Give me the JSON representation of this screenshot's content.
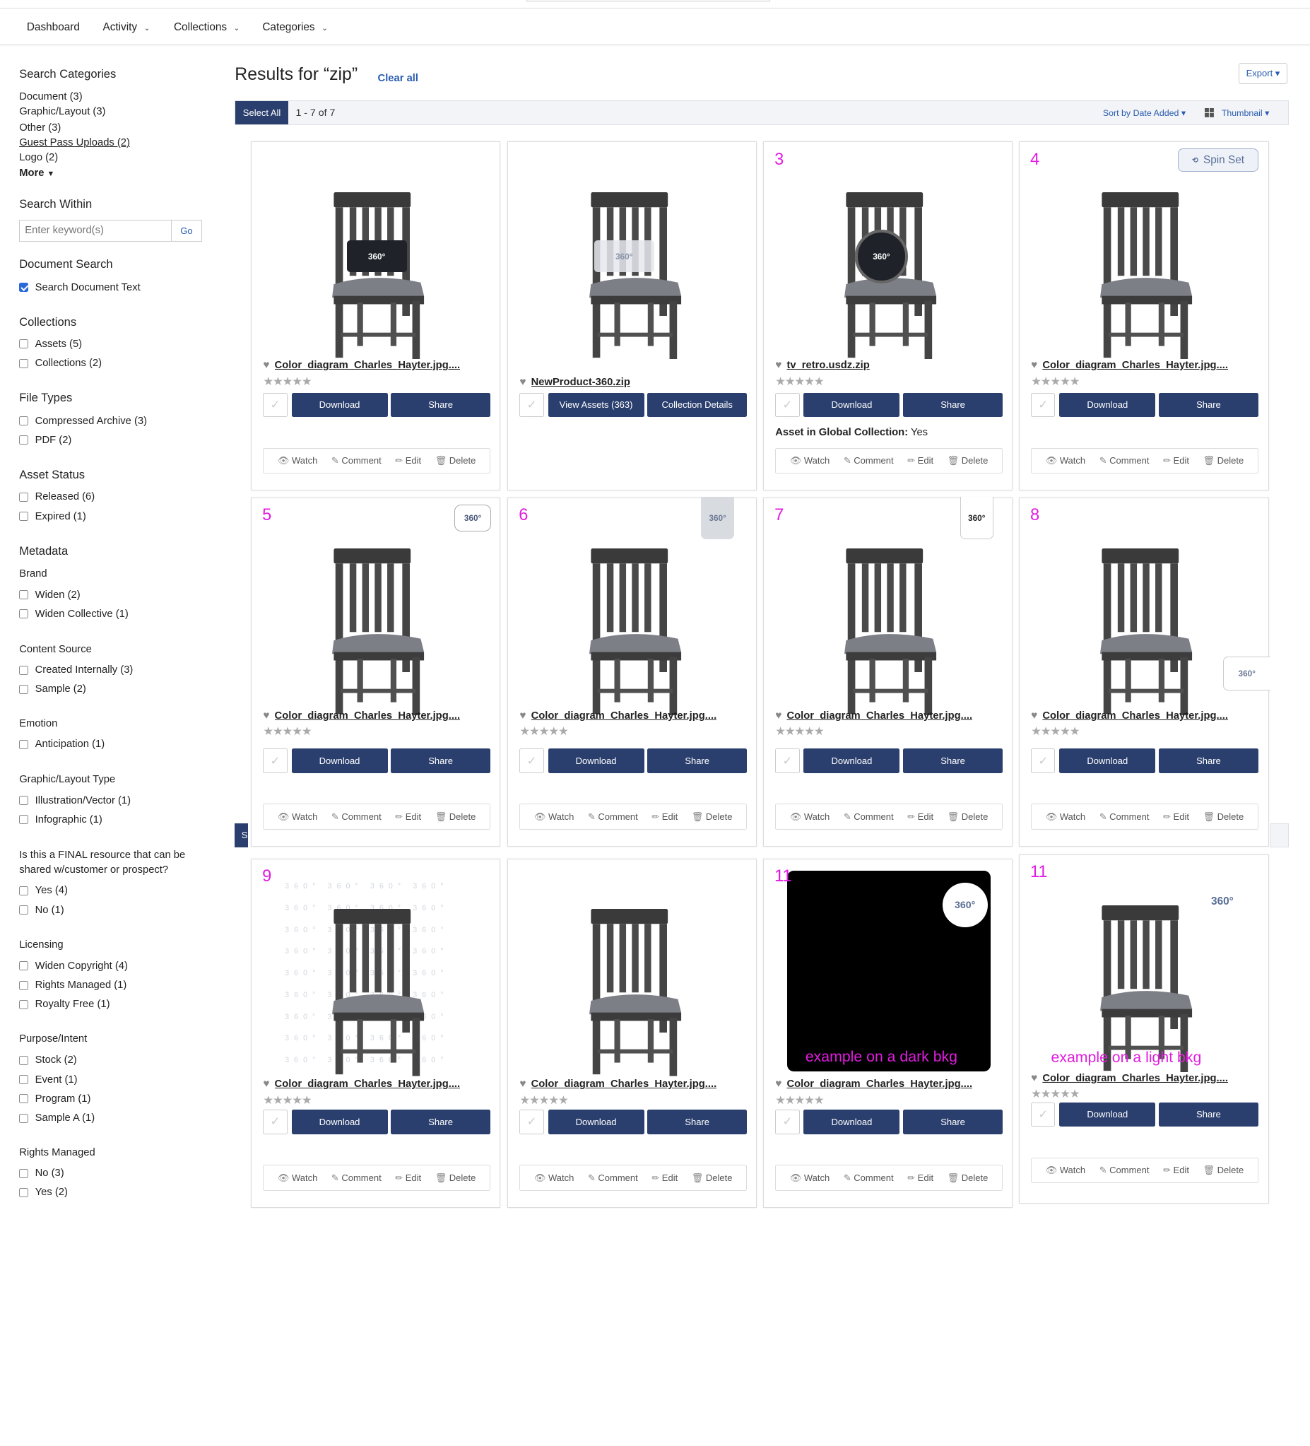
{
  "nav": {
    "items": [
      {
        "label": "Dashboard",
        "dropdown": false
      },
      {
        "label": "Activity",
        "dropdown": true
      },
      {
        "label": "Collections",
        "dropdown": true
      },
      {
        "label": "Categories",
        "dropdown": true
      }
    ]
  },
  "sidebar": {
    "search_categories": {
      "title": "Search Categories",
      "items": [
        "Document (3)",
        "Graphic/Layout (3)",
        "Other (3)",
        "Guest Pass Uploads (2)",
        "Logo (2)"
      ],
      "more": "More"
    },
    "search_within": {
      "title": "Search Within",
      "placeholder": "Enter keyword(s)",
      "go": "Go"
    },
    "document_search": {
      "title": "Document Search",
      "option": "Search Document Text"
    },
    "collections": {
      "title": "Collections",
      "items": [
        "Assets (5)",
        "Collections (2)"
      ]
    },
    "file_types": {
      "title": "File Types",
      "items": [
        "Compressed Archive (3)",
        "PDF (2)"
      ]
    },
    "asset_status": {
      "title": "Asset Status",
      "items": [
        "Released (6)",
        "Expired (1)"
      ]
    },
    "metadata": {
      "title": "Metadata"
    },
    "brand": {
      "title": "Brand",
      "items": [
        "Widen (2)",
        "Widen Collective (1)"
      ]
    },
    "content_source": {
      "title": "Content Source",
      "items": [
        "Created Internally (3)",
        "Sample (2)"
      ]
    },
    "emotion": {
      "title": "Emotion",
      "items": [
        "Anticipation (1)"
      ]
    },
    "layout_type": {
      "title": "Graphic/Layout Type",
      "items": [
        "Illustration/Vector (1)",
        "Infographic (1)"
      ]
    },
    "final_resource": {
      "title_line1": "Is this a FINAL resource that can be",
      "title_line2": "shared w/customer or prospect?",
      "items": [
        "Yes (4)",
        "No (1)"
      ]
    },
    "licensing": {
      "title": "Licensing",
      "items": [
        "Widen Copyright (4)",
        "Rights Managed (1)",
        "Royalty Free (1)"
      ]
    },
    "purpose": {
      "title": "Purpose/Intent",
      "items": [
        "Stock (2)",
        "Event (1)",
        "Program (1)",
        "Sample A (1)"
      ]
    },
    "rights_managed": {
      "title": "Rights Managed",
      "items": [
        "No (3)",
        "Yes (2)"
      ]
    }
  },
  "results": {
    "title": "Results for “zip”",
    "clear_all": "Clear all",
    "export": "Export ▾",
    "select_all": "Select All",
    "count": "1 - 7 of 7",
    "sort": "Sort by Date Added ▾",
    "view": "Thumbnail ▾",
    "strip_letter": "S"
  },
  "labels": {
    "download": "Download",
    "share": "Share",
    "view_assets": "View Assets (363)",
    "collection_details": "Collection Details",
    "watch": "Watch",
    "comment": "Comment",
    "edit": "Edit",
    "delete": "Delete",
    "spin_set": "Spin Set",
    "badge_360": "360°",
    "stars": "★★★★★",
    "heart": "♥",
    "check": "✓"
  },
  "cards": [
    {
      "num": "",
      "name": "Color_diagram_Charles_Hayter.jpg....",
      "info_label": "",
      "info_value": ""
    },
    {
      "num": "",
      "name": "NewProduct-360.zip"
    },
    {
      "num": "3",
      "name": "tv_retro.usdz.zip",
      "info_label": "Asset in Global Collection:",
      "info_value": "Yes"
    },
    {
      "num": "4",
      "name": "Color_diagram_Charles_Hayter.jpg...."
    },
    {
      "num": "5",
      "name": "Color_diagram_Charles_Hayter.jpg...."
    },
    {
      "num": "6",
      "name": "Color_diagram_Charles_Hayter.jpg...."
    },
    {
      "num": "7",
      "name": "Color_diagram_Charles_Hayter.jpg...."
    },
    {
      "num": "8",
      "name": "Color_diagram_Charles_Hayter.jpg...."
    },
    {
      "num": "9",
      "name": "Color_diagram_Charles_Hayter.jpg...."
    },
    {
      "num": "",
      "name": "Color_diagram_Charles_Hayter.jpg...."
    },
    {
      "num": "11",
      "name": "Color_diagram_Charles_Hayter.jpg....",
      "note": "example on a dark bkg"
    },
    {
      "num": "11",
      "name": "Color_diagram_Charles_Hayter.jpg....",
      "note": "example on a light bkg"
    }
  ],
  "colors": {
    "primary_button": "#2b3f6e",
    "link": "#2a5db0",
    "annotation": "#e21ce0"
  }
}
